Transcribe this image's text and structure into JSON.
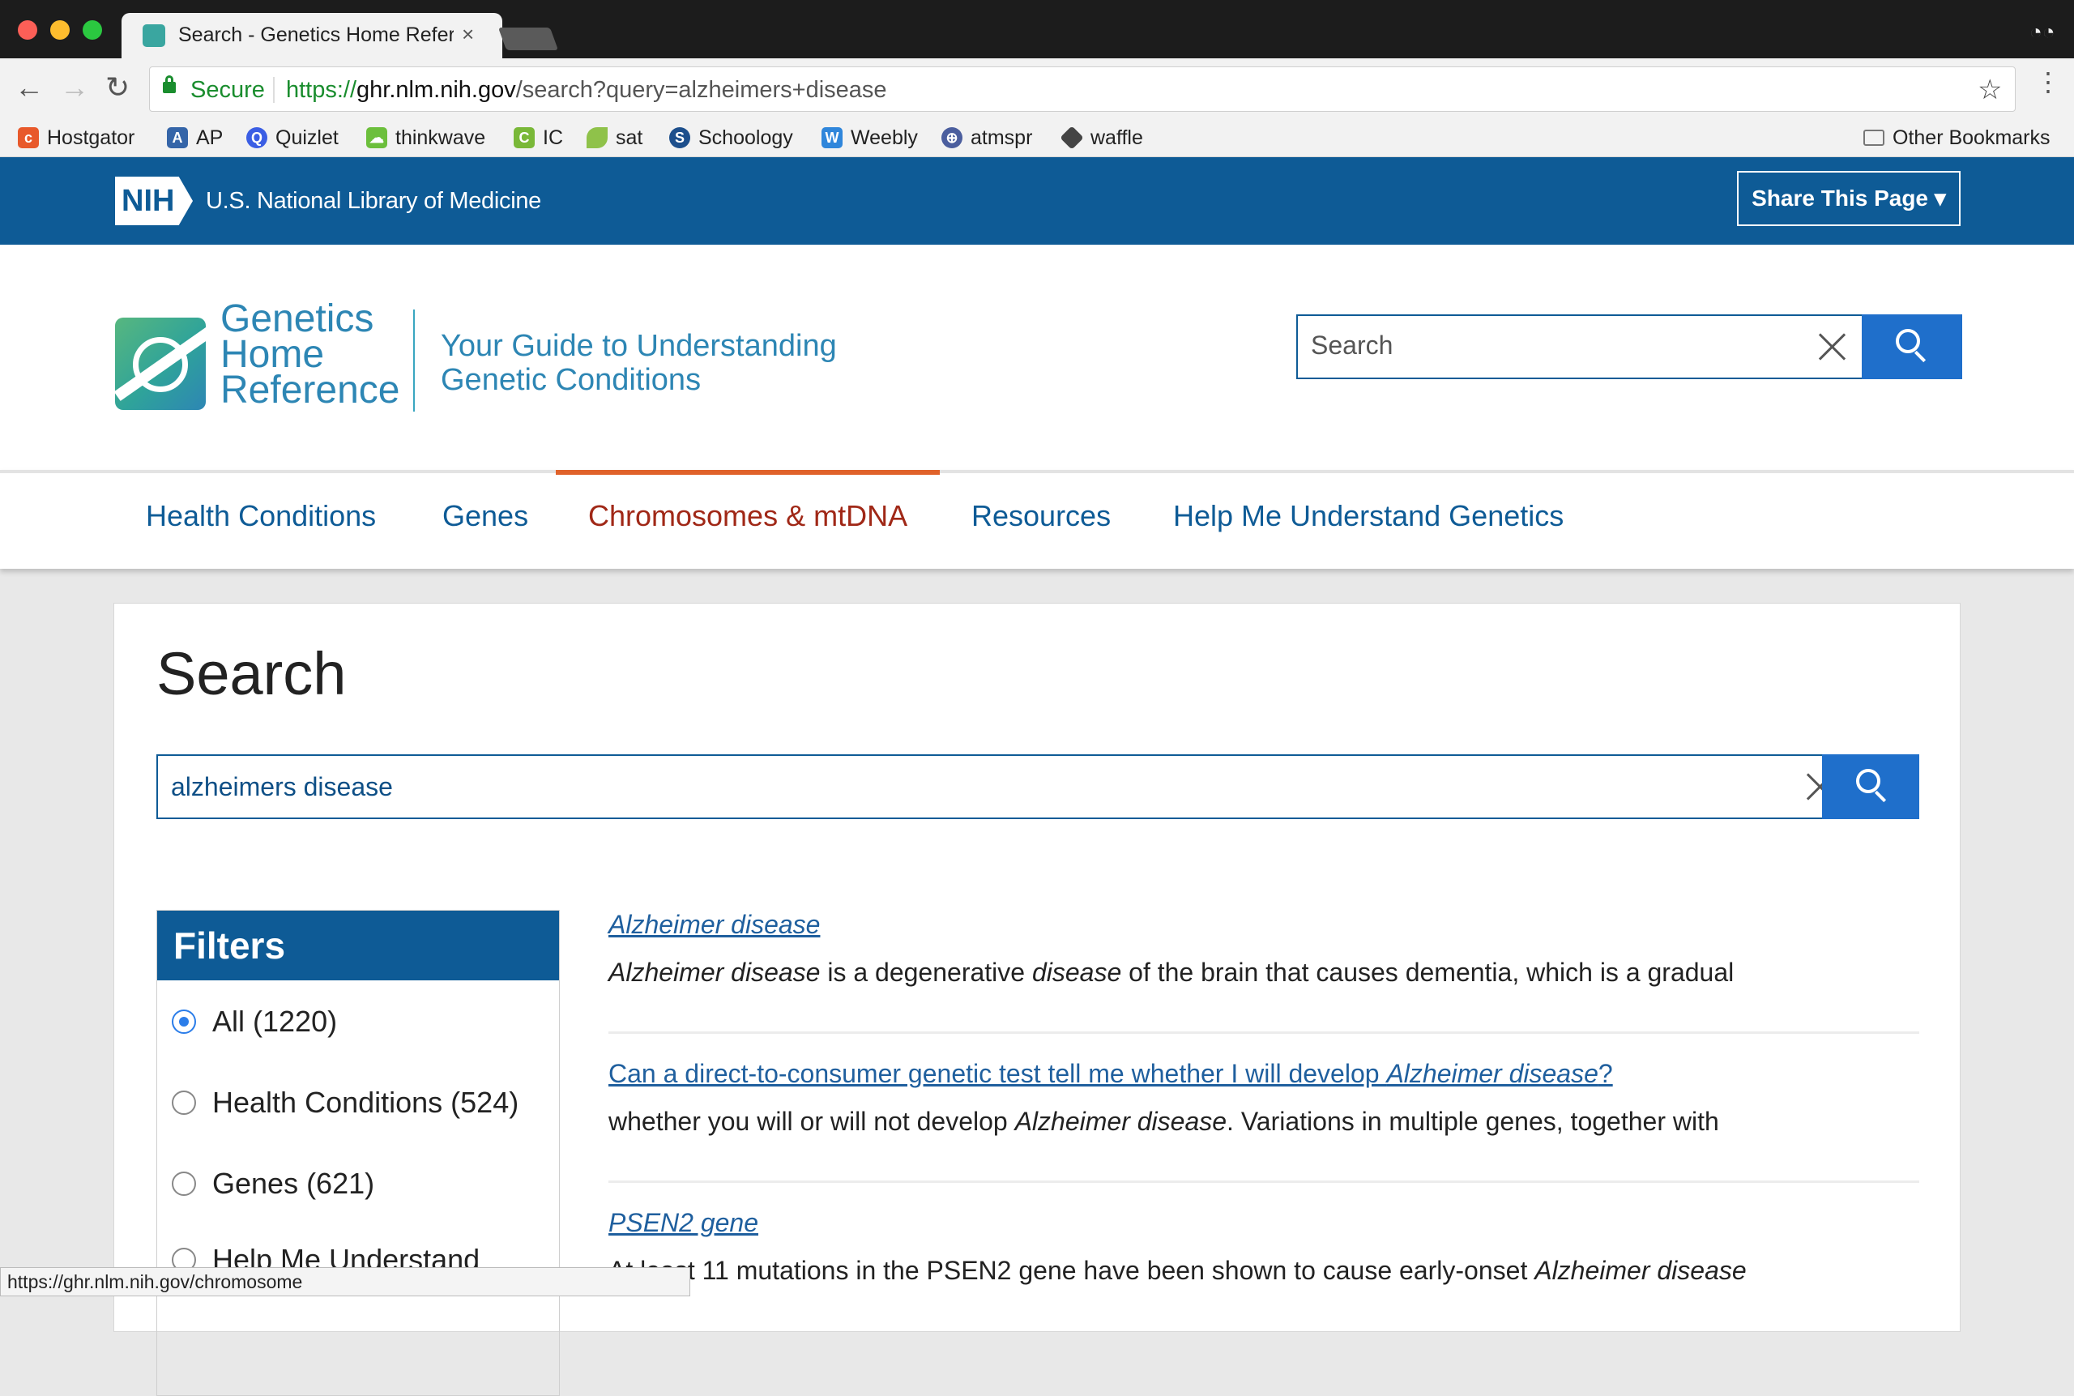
{
  "browser": {
    "tab_title": "Search - Genetics Home Reference",
    "tab_close": "×",
    "secure_label": "Secure",
    "url_proto": "https://",
    "url_host": "ghr.nlm.nih.gov",
    "url_path": "/search?query=alzheimers+disease",
    "bookmarks": [
      {
        "label": "Hostgator",
        "icon": "cpanel-icon",
        "color": "#e8592b"
      },
      {
        "label": "AP",
        "icon": "shield-icon",
        "color": "#3565a8"
      },
      {
        "label": "Quizlet",
        "icon": "quizlet-icon",
        "color": "#3b5ee4"
      },
      {
        "label": "thinkwave",
        "icon": "cloud-icon",
        "color": "#6cbf3c"
      },
      {
        "label": "IC",
        "icon": "ic-icon",
        "color": "#79b838"
      },
      {
        "label": "sat",
        "icon": "leaf-icon",
        "color": "#8fc24a"
      },
      {
        "label": "Schoology",
        "icon": "schoology-icon",
        "color": "#1d4f8c"
      },
      {
        "label": "Weebly",
        "icon": "weebly-icon",
        "color": "#2f86db"
      },
      {
        "label": "atmspr",
        "icon": "globe-icon",
        "color": "#4b5e9e"
      },
      {
        "label": "waffle",
        "icon": "waffle-icon",
        "color": "#444444"
      }
    ],
    "other_bookmarks": "Other Bookmarks",
    "status_url": "https://ghr.nlm.nih.gov/chromosome"
  },
  "nih": {
    "badge": "NIH",
    "name": "U.S. National Library of Medicine",
    "share_label": "Share This Page ▾"
  },
  "header": {
    "logo_line1": "Genetics",
    "logo_line2": "Home",
    "logo_line3": "Reference",
    "tagline_line1": "Your Guide to Understanding",
    "tagline_line2": "Genetic Conditions",
    "search_placeholder": "Search"
  },
  "nav": {
    "items": [
      {
        "label": "Health Conditions"
      },
      {
        "label": "Genes"
      },
      {
        "label": "Chromosomes & mtDNA"
      },
      {
        "label": "Resources"
      },
      {
        "label": "Help Me Understand Genetics"
      }
    ],
    "active_index": 2
  },
  "main": {
    "title": "Search",
    "query": "alzheimers disease",
    "filters_title": "Filters",
    "filters": [
      {
        "label": "All (1220)",
        "selected": true
      },
      {
        "label": "Health Conditions (524)",
        "selected": false
      },
      {
        "label": "Genes (621)",
        "selected": false
      },
      {
        "label": "Help Me Understand",
        "selected": false
      }
    ],
    "results": [
      {
        "title": "Alzheimer disease",
        "snippet_a": "Alzheimer disease",
        "snippet_b": " is a degenerative ",
        "snippet_c": "disease",
        "snippet_d": " of the brain that causes dementia, which is a gradual"
      },
      {
        "title_a": "Can a direct-to-consumer genetic test tell me whether I will develop ",
        "title_b": "Alzheimer disease",
        "title_c": "?",
        "snippet_a": "whether you will or will not develop ",
        "snippet_b": "Alzheimer disease",
        "snippet_c": ". Variations in multiple genes, together with"
      },
      {
        "title": "PSEN2 gene",
        "snippet_a": "At least 11 mutations in the PSEN2 gene have been shown to cause early-onset ",
        "snippet_b": "Alzheimer disease"
      }
    ]
  }
}
